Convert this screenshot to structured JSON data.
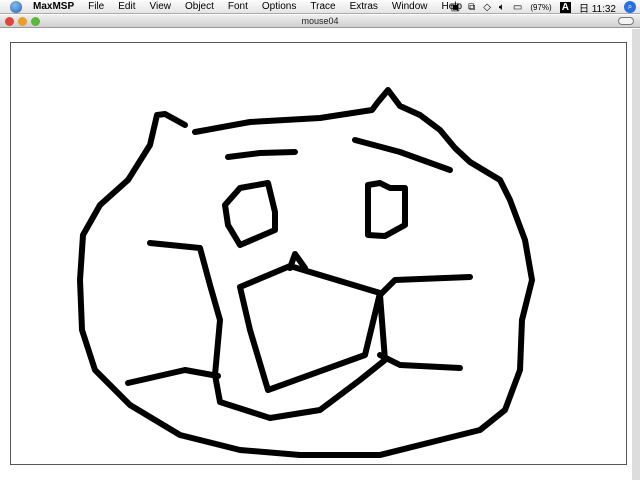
{
  "menubar": {
    "app": "MaxMSP",
    "items": [
      "File",
      "Edit",
      "View",
      "Object",
      "Font",
      "Options",
      "Trace",
      "Extras",
      "Window",
      "Help"
    ],
    "battery": "(97%)",
    "clock": "日 11:32"
  },
  "window": {
    "title": "mouse04"
  },
  "colors": {
    "stroke": "#000000"
  }
}
